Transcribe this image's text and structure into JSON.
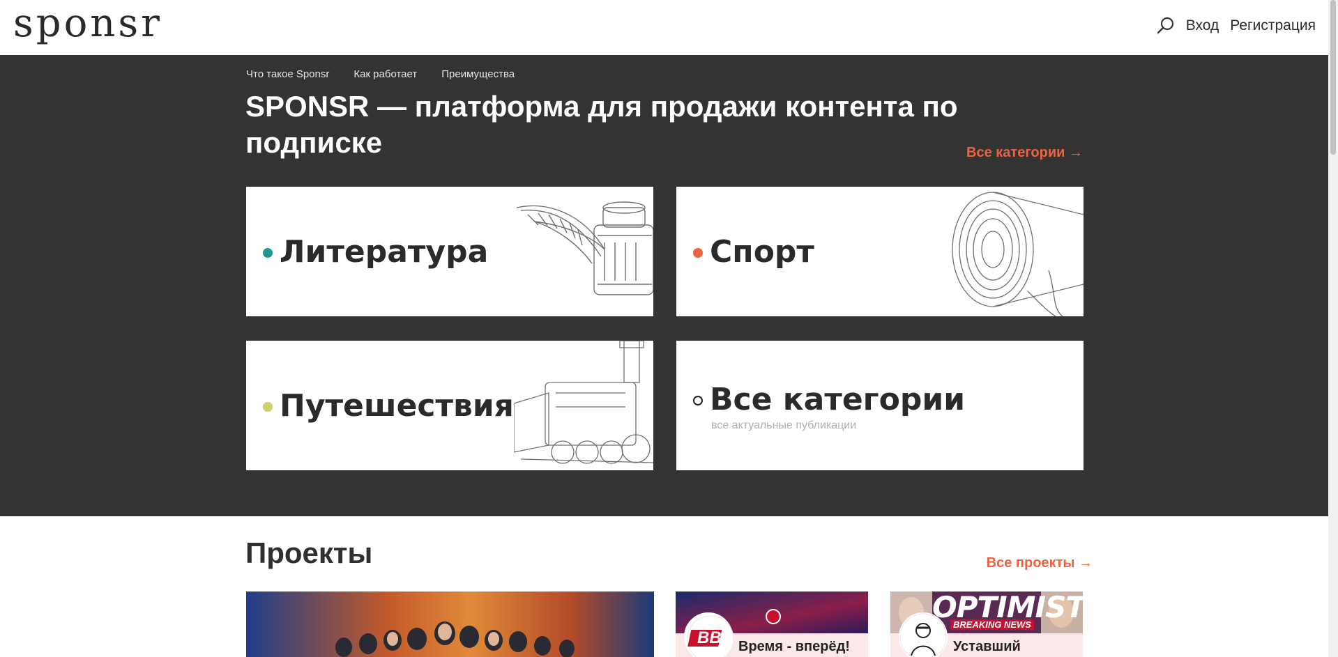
{
  "header": {
    "logo": "sponsr",
    "login": "Вход",
    "register": "Регистрация",
    "icons": {
      "search": "search-icon"
    }
  },
  "hero": {
    "subnav": [
      "Что такое Sponsr",
      "Как работает",
      "Преимущества"
    ],
    "title": "SPONSR — платформа для продажи контента по подписке",
    "all_categories_link": "Все категории →",
    "categories": [
      {
        "label": "Литература",
        "dot_color": "#1e9a8c",
        "icon": "quill-inkwell-icon"
      },
      {
        "label": "Спорт",
        "dot_color": "#ee6442",
        "icon": "megaphone-icon"
      },
      {
        "label": "Путешествия",
        "dot_color": "#cdd36b",
        "icon": "locomotive-icon"
      },
      {
        "label": "Все категории",
        "subtitle": "все актуальные публикации",
        "dot_color": "#ffffff"
      }
    ]
  },
  "projects": {
    "title": "Проекты",
    "all_projects_link": "Все проекты →",
    "items": [
      {
        "name": ""
      },
      {
        "name": "Время - вперёд!",
        "badge_text": "BB"
      },
      {
        "name": "Уставший",
        "banner_text": "OPTIMIST",
        "banner_sub": "BREAKING NEWS"
      }
    ]
  },
  "colors": {
    "accent": "#ee6442",
    "hero_bg": "#333333"
  }
}
